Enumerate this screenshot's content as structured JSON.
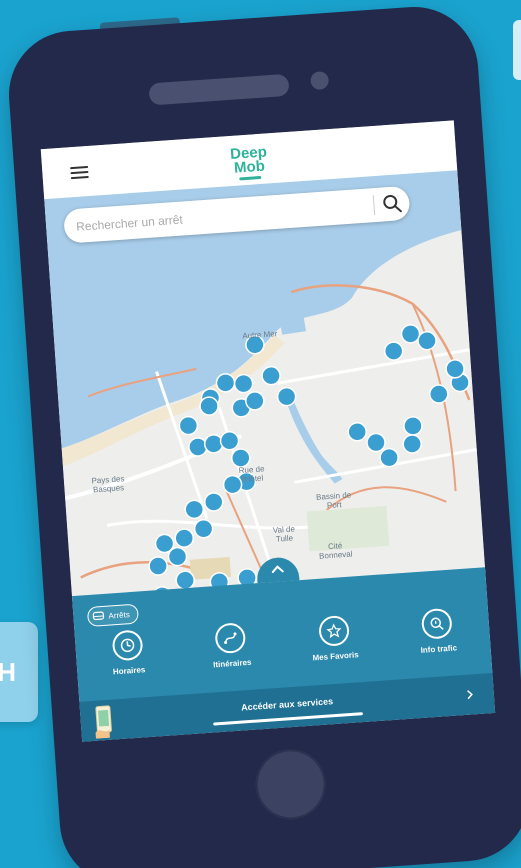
{
  "app": {
    "logo_line1": "Deep",
    "logo_line2": "Mob"
  },
  "search": {
    "placeholder": "Rechercher un arrêt"
  },
  "map": {
    "labels": [
      "Autre Mer",
      "Pays des Basques",
      "Bassin de Port",
      "Rue de l'Hôtel",
      "Val de Tulle",
      "Cité Bonneval"
    ],
    "stop_icon_color": "#3a9fd0",
    "water_color": "#a8cdea",
    "road_color": "#e8a27f",
    "accent_color": "#2fb39a"
  },
  "panel": {
    "badge_label": "Arrêts",
    "actions": [
      {
        "label": "Horaires",
        "icon": "clock-icon"
      },
      {
        "label": "Itinéraires",
        "icon": "route-icon"
      },
      {
        "label": "Mes Favoris",
        "icon": "star-icon"
      },
      {
        "label": "Info trafic",
        "icon": "traffic-info-icon"
      }
    ],
    "bottom_text": "Accéder aux services",
    "panel_color": "#2a89ac"
  },
  "background": {
    "left_card_text": "H",
    "color": "#1aa3cf"
  }
}
